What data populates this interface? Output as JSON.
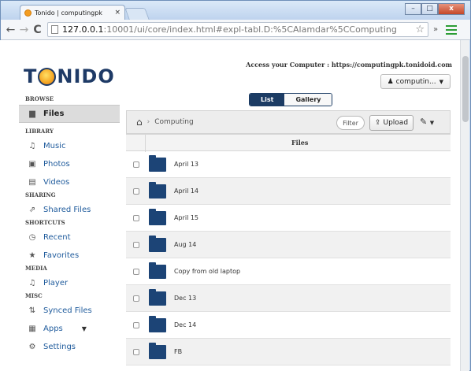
{
  "browser": {
    "tab_title": "Tonido | computingpk",
    "tab_close": "×",
    "url_host": "127.0.0.1",
    "url_path": ":10001/ui/core/index.html#expl-tabl.D:%5CAlamdar%5CComputing",
    "window_buttons": [
      "–",
      "□",
      "x"
    ],
    "ext_label": "»"
  },
  "app": {
    "logo_left": "T",
    "logo_right": "NIDO",
    "access_note": "Access your Computer : https://computingpk.tonidoid.com",
    "account_label": "computin...",
    "view_toggle": [
      "List",
      "Gallery"
    ],
    "breadcrumb": "Computing",
    "filter_label": "Filter",
    "upload_label": "Upload",
    "files_header": "Files"
  },
  "sidebar": {
    "browse": "BROWSE",
    "files": "Files",
    "library": "LIBRARY",
    "music": "Music",
    "photos": "Photos",
    "videos": "Videos",
    "sharing": "SHARING",
    "shared_files": "Shared Files",
    "shortcuts": "SHORTCUTS",
    "recent": "Recent",
    "favorites": "Favorites",
    "media": "MEDIA",
    "player": "Player",
    "misc": "MISC",
    "synced_files": "Synced Files",
    "apps": "Apps",
    "settings": "Settings"
  },
  "files": [
    {
      "name": "April 13"
    },
    {
      "name": "April 14"
    },
    {
      "name": "April 15"
    },
    {
      "name": "Aug 14"
    },
    {
      "name": "Copy from old laptop"
    },
    {
      "name": "Dec 13"
    },
    {
      "name": "Dec 14"
    },
    {
      "name": "FB"
    }
  ],
  "colors": {
    "brand_navy": "#1c3c64",
    "folder_blue": "#1c4476",
    "link_blue": "#1f5b9c",
    "logo_orange": "#f5a623"
  },
  "icons": [
    "home-icon",
    "upload-icon",
    "wrench-icon",
    "user-icon",
    "folder-icon",
    "music-icon",
    "photo-icon",
    "video-icon",
    "share-icon",
    "clock-icon",
    "star-icon",
    "sync-icon",
    "apps-icon",
    "gear-icon"
  ]
}
